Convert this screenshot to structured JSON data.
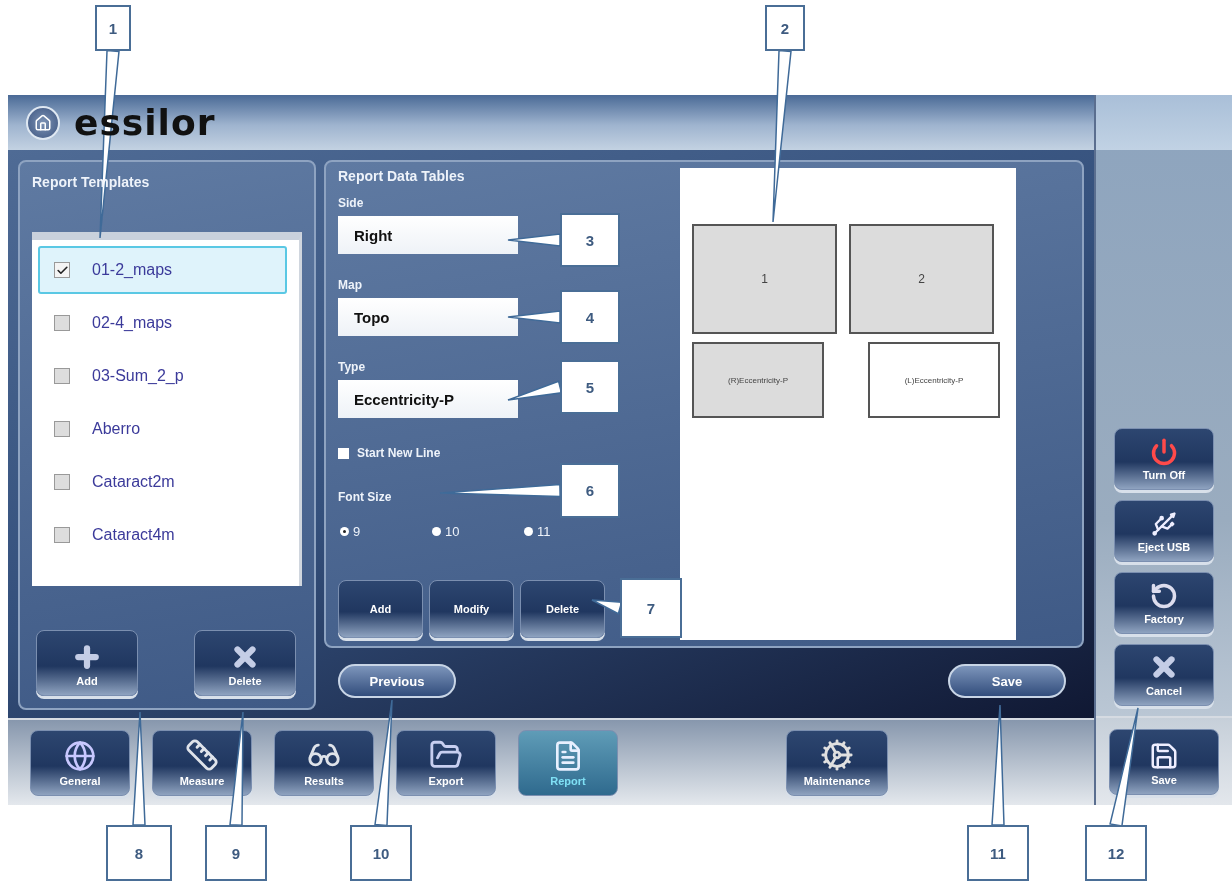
{
  "header": {
    "logo": "essilor"
  },
  "templates": {
    "title": "Report Templates",
    "items": [
      {
        "name": "01-2_maps",
        "checked": true,
        "selected": true
      },
      {
        "name": "02-4_maps",
        "checked": false,
        "selected": false
      },
      {
        "name": "03-Sum_2_p",
        "checked": false,
        "selected": false
      },
      {
        "name": "Aberro",
        "checked": false,
        "selected": false
      },
      {
        "name": "Cataract2m",
        "checked": false,
        "selected": false
      },
      {
        "name": "Cataract4m",
        "checked": false,
        "selected": false
      }
    ],
    "buttons": [
      {
        "label": "Add"
      },
      {
        "label": "Delete"
      }
    ]
  },
  "data_tables": {
    "title": "Report Data Tables",
    "fields": [
      {
        "label": "Side",
        "value": "Right"
      },
      {
        "label": "Map",
        "value": "Topo"
      },
      {
        "label": "Type",
        "value": "Eccentricity-P"
      }
    ],
    "start_new_line": {
      "label": "Start New Line",
      "checked": false
    },
    "font_size": {
      "label": "Font Size",
      "options": [
        {
          "label": "9",
          "selected": true
        },
        {
          "label": "10",
          "selected": false
        },
        {
          "label": "11",
          "selected": false
        }
      ]
    },
    "buttons": [
      "Add",
      "Modify",
      "Delete"
    ]
  },
  "preview": {
    "maps": [
      {
        "label": "1",
        "selected": true
      },
      {
        "label": "2",
        "selected": true
      }
    ],
    "tables": [
      {
        "label": "(R)Eccentricity-P",
        "selected": true
      },
      {
        "label": "(L)Eccentricity-P",
        "selected": false
      }
    ]
  },
  "previous_button": "Previous",
  "save_button": "Save",
  "nav": [
    {
      "label": "General",
      "selected": false
    },
    {
      "label": "Measure",
      "selected": false
    },
    {
      "label": "Results",
      "selected": false
    },
    {
      "label": "Export",
      "selected": false
    },
    {
      "label": "Report",
      "selected": true
    },
    {
      "label": "Maintenance",
      "selected": false
    }
  ],
  "side_buttons": [
    {
      "label": "Turn Off"
    },
    {
      "label": "Eject USB"
    },
    {
      "label": "Factory"
    },
    {
      "label": "Cancel"
    }
  ],
  "side_save": {
    "label": "Save"
  },
  "callouts": [
    "1",
    "2",
    "3",
    "4",
    "5",
    "6",
    "7",
    "8",
    "9",
    "10",
    "11",
    "12"
  ]
}
